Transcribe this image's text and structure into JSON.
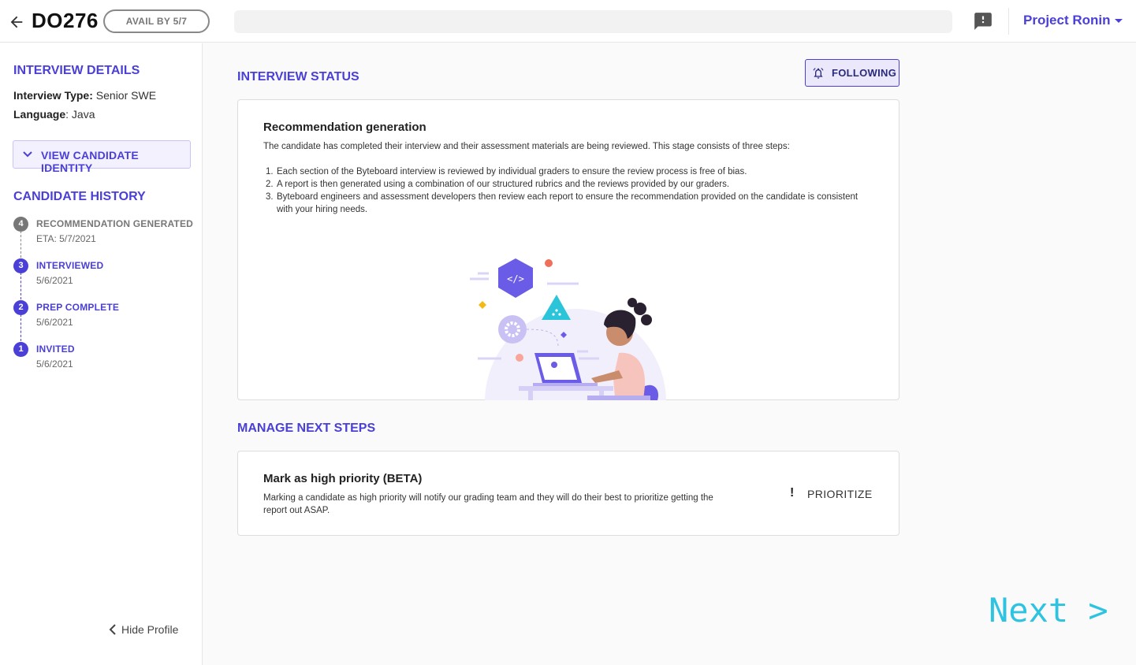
{
  "header": {
    "candidate_id": "DO276",
    "availability_badge": "AVAIL BY 5/7",
    "project_name": "Project Ronin"
  },
  "sidebar": {
    "interview_details_title": "INTERVIEW DETAILS",
    "interview_type_label": "Interview Type:",
    "interview_type_value": "Senior SWE",
    "language_label": "Language",
    "language_value": ": Java",
    "view_identity_label": "VIEW CANDIDATE IDENTITY",
    "candidate_history_title": "CANDIDATE HISTORY",
    "history": [
      {
        "step": "4",
        "label": "RECOMMENDATION GENERATED",
        "date": "ETA: 5/7/2021"
      },
      {
        "step": "3",
        "label": "INTERVIEWED",
        "date": "5/6/2021"
      },
      {
        "step": "2",
        "label": "PREP COMPLETE",
        "date": "5/6/2021"
      },
      {
        "step": "1",
        "label": "INVITED",
        "date": "5/6/2021"
      }
    ],
    "hide_profile_label": "Hide Profile"
  },
  "main": {
    "interview_status_title": "INTERVIEW STATUS",
    "following_label": "FOLLOWING",
    "status_card": {
      "title": "Recommendation generation",
      "intro": "The candidate has completed their interview and their assessment materials are being reviewed. This stage consists of three steps:",
      "steps": [
        {
          "n": "1.",
          "text": "Each section of the Byteboard interview is reviewed by individual graders to ensure the review process is free of bias."
        },
        {
          "n": "2.",
          "text": "A report is then generated using a combination of our structured rubrics and the reviews provided by our graders."
        },
        {
          "n": "3.",
          "text": "Byteboard engineers and assessment developers then review each report to ensure the recommendation provided on the candidate is consistent with your hiring needs."
        }
      ]
    },
    "manage_next_steps_title": "MANAGE NEXT STEPS",
    "priority_card": {
      "title": "Mark as high priority (BETA)",
      "description": "Marking a candidate as high priority will notify our grading team and they will do their best to prioritize getting the report out ASAP.",
      "prioritize_label": "PRIORITIZE",
      "prioritize_symbol": "!"
    },
    "next_label": "Next >"
  },
  "colors": {
    "accent": "#4a3fd6",
    "next": "#2ec3e0",
    "pending_step": "#777777"
  },
  "icons": [
    "back-arrow-icon",
    "feedback-icon",
    "caret-down-icon",
    "chevron-down-icon",
    "bell-icon",
    "chevron-left-icon"
  ]
}
